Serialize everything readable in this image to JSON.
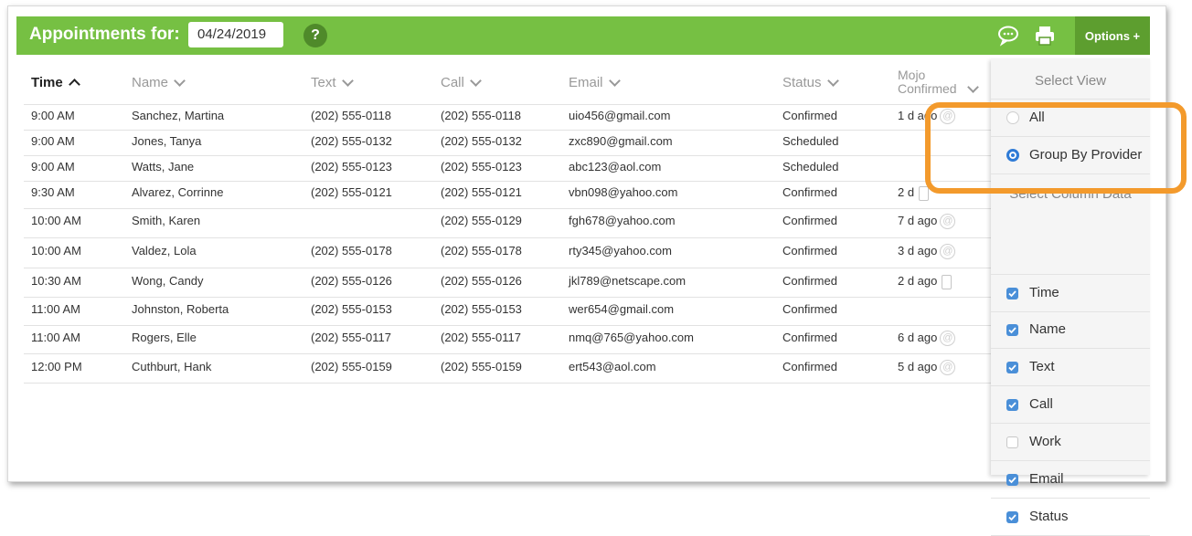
{
  "toolbar": {
    "title": "Appointments for:",
    "date_value": "04/24/2019",
    "help_label": "?",
    "options_label": "Options +"
  },
  "columns": [
    {
      "label": "Time",
      "sort": "up"
    },
    {
      "label": "Name",
      "sort": "down"
    },
    {
      "label": "Text",
      "sort": "down"
    },
    {
      "label": "Call",
      "sort": "down"
    },
    {
      "label": "Email",
      "sort": "down"
    },
    {
      "label": "Status",
      "sort": "down"
    },
    {
      "label": "Mojo Confirmed",
      "sort": "down"
    }
  ],
  "rows": [
    {
      "time": "9:00 AM",
      "name": "Sanchez, Martina",
      "text": "(202) 555-0118",
      "call": "(202) 555-0118",
      "email": "uio456@gmail.com",
      "status": "Confirmed",
      "mojo": "1 d ago",
      "mojo_icon": "at-icon"
    },
    {
      "time": "9:00 AM",
      "name": "Jones, Tanya",
      "text": "(202) 555-0132",
      "call": "(202) 555-0132",
      "email": "zxc890@gmail.com",
      "status": "Scheduled",
      "mojo": "",
      "mojo_icon": ""
    },
    {
      "time": "9:00 AM",
      "name": "Watts, Jane",
      "text": "(202) 555-0123",
      "call": "(202) 555-0123",
      "email": "abc123@aol.com",
      "status": "Scheduled",
      "mojo": "",
      "mojo_icon": ""
    },
    {
      "time": "9:30 AM",
      "name": "Alvarez, Corrinne",
      "text": "(202) 555-0121",
      "call": "(202) 555-0121",
      "email": "vbn098@yahoo.com",
      "status": "Confirmed",
      "mojo": "2 d",
      "mojo_icon": "phone-icon"
    },
    {
      "time": "10:00 AM",
      "name": "Smith, Karen",
      "text": "",
      "call": "(202) 555-0129",
      "email": "fgh678@yahoo.com",
      "status": "Confirmed",
      "mojo": "7 d ago",
      "mojo_icon": "at-icon"
    },
    {
      "time": "10:00 AM",
      "name": "Valdez, Lola",
      "text": "(202) 555-0178",
      "call": "(202) 555-0178",
      "email": "rty345@yahoo.com",
      "status": "Confirmed",
      "mojo": "3 d ago",
      "mojo_icon": "at-icon"
    },
    {
      "time": "10:30 AM",
      "name": "Wong, Candy",
      "text": "(202) 555-0126",
      "call": "(202) 555-0126",
      "email": "jkl789@netscape.com",
      "status": "Confirmed",
      "mojo": "2 d ago",
      "mojo_icon": "phone-icon"
    },
    {
      "time": "11:00 AM",
      "name": "Johnston, Roberta",
      "text": "(202) 555-0153",
      "call": "(202) 555-0153",
      "email": "wer654@gmail.com",
      "status": "Confirmed",
      "mojo": "",
      "mojo_icon": ""
    },
    {
      "time": "11:00 AM",
      "name": "Rogers, Elle",
      "text": "(202) 555-0117",
      "call": "(202) 555-0117",
      "email": "nmq@765@yahoo.com",
      "status": "Confirmed",
      "mojo": "6 d ago",
      "mojo_icon": "at-icon"
    },
    {
      "time": "12:00 PM",
      "name": "Cuthburt, Hank",
      "text": "(202) 555-0159",
      "call": "(202) 555-0159",
      "email": "ert543@aol.com",
      "status": "Confirmed",
      "mojo": "5 d ago",
      "mojo_icon": "at-icon"
    }
  ],
  "options_panel": {
    "select_view_label": "Select View",
    "views": [
      {
        "label": "All",
        "selected": false
      },
      {
        "label": "Group By Provider",
        "selected": true
      }
    ],
    "select_columns_label": "Select Column Data",
    "columns": [
      {
        "label": "Time",
        "checked": true
      },
      {
        "label": "Name",
        "checked": true
      },
      {
        "label": "Text",
        "checked": true
      },
      {
        "label": "Call",
        "checked": true
      },
      {
        "label": "Work",
        "checked": false
      },
      {
        "label": "Email",
        "checked": true
      },
      {
        "label": "Status",
        "checked": true
      }
    ]
  },
  "colors": {
    "toolbar_green": "#76c043",
    "options_green": "#5d9e2f",
    "highlight_orange": "#f39a2c",
    "check_blue": "#4a8fd8"
  }
}
